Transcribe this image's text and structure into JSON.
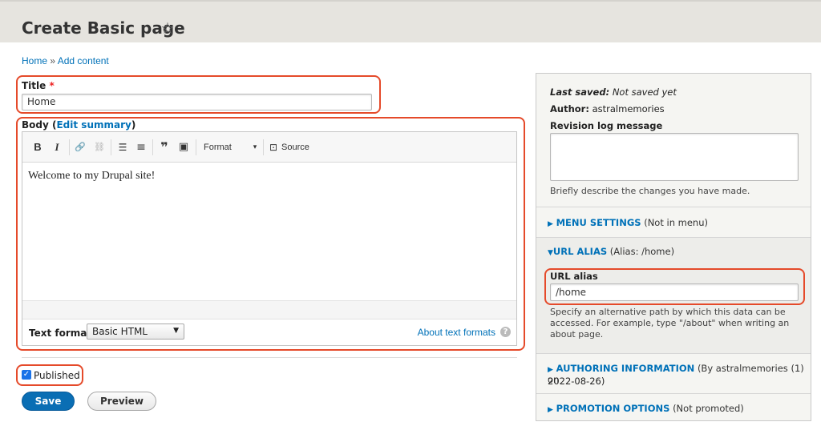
{
  "header": {
    "title": "Create Basic page",
    "star": "☆"
  },
  "breadcrumb": {
    "home": "Home",
    "separator": "»",
    "add_content": "Add content"
  },
  "title_field": {
    "label": "Title",
    "required": "*",
    "value": "Home"
  },
  "body_field": {
    "label": "Body",
    "paren_open": "(",
    "edit_summary": "Edit summary",
    "paren_close": ")",
    "content": "Welcome to my Drupal site!"
  },
  "toolbar": {
    "bold": "B",
    "italic": "I",
    "link": "🔗",
    "unlink": "⛓",
    "bullet_list": "☰",
    "numbered_list": "≡",
    "blockquote": "❞",
    "image": "▣",
    "format": "Format",
    "format_arrow": "▾",
    "source_icon": "⊡",
    "source": "Source"
  },
  "text_format": {
    "label": "Text format",
    "selected": "Basic HTML",
    "arrow": "▼",
    "about": "About text formats",
    "help_icon": "?"
  },
  "published": {
    "label": "Published",
    "checked": true
  },
  "actions": {
    "save": "Save",
    "preview": "Preview"
  },
  "sidebar": {
    "last_saved_label": "Last saved:",
    "last_saved_value": "Not saved yet",
    "author_label": "Author:",
    "author_value": "astralmemories",
    "revision_label": "Revision log message",
    "revision_value": "",
    "revision_desc": "Briefly describe the changes you have made.",
    "menu_settings": {
      "arrow": "▶",
      "title": "MENU SETTINGS",
      "summary": "(Not in menu)"
    },
    "url_alias": {
      "arrow": "▼",
      "title": "URL ALIAS",
      "summary": "(Alias: /home)",
      "field_label": "URL alias",
      "value": "/home",
      "desc_line1": "Specify an alternative path by which this data can be",
      "desc_line2": "accessed. For example, type \"/about\" when writing an",
      "desc_line3": "about page."
    },
    "authoring": {
      "arrow": "▶",
      "title": "AUTHORING INFORMATION",
      "summary": "(By astralmemories (1) on",
      "summary2": "2022-08-26)"
    },
    "promotion": {
      "arrow": "▶",
      "title": "PROMOTION OPTIONS",
      "summary": "(Not promoted)"
    }
  },
  "colors": {
    "accent": "#0071b8",
    "highlight": "#e54a2a",
    "save_button": "#0a6eb4"
  }
}
